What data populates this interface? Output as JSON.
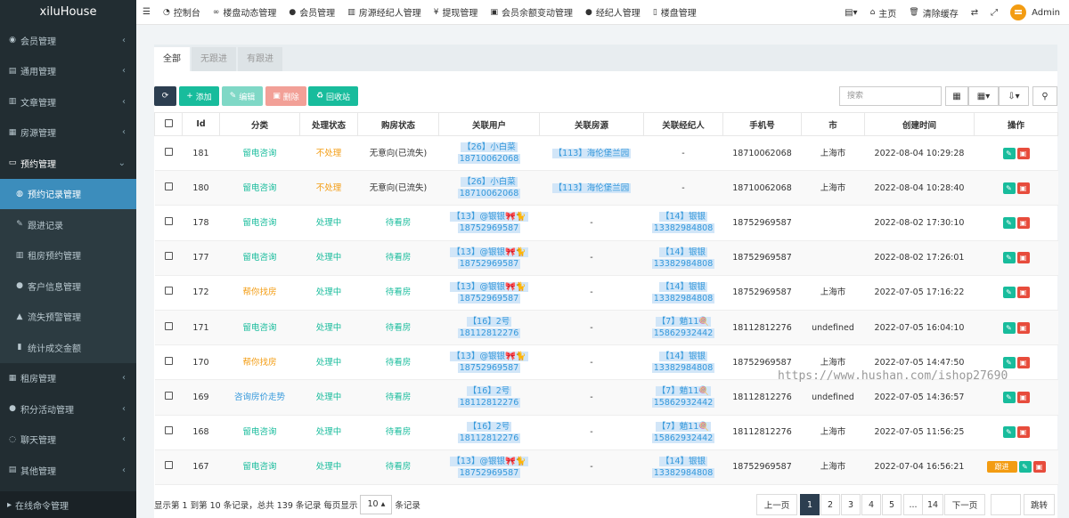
{
  "brand": "xiluHouse",
  "sidebar": {
    "items": [
      {
        "label": "会员管理",
        "icon": "user-circle-icon",
        "chev": "‹"
      },
      {
        "label": "通用管理",
        "icon": "list-icon",
        "chev": "‹"
      },
      {
        "label": "文章管理",
        "icon": "file-icon",
        "chev": "‹"
      },
      {
        "label": "房源管理",
        "icon": "table-icon",
        "chev": "‹"
      },
      {
        "label": "预约管理",
        "icon": "laptop-icon",
        "chev": "⌄"
      }
    ],
    "sub_items": [
      {
        "label": "预约记录管理",
        "icon": "globe-icon"
      },
      {
        "label": "跟进记录",
        "icon": "pen-icon"
      },
      {
        "label": "租房预约管理",
        "icon": "file-icon"
      },
      {
        "label": "客户信息管理",
        "icon": "user-icon"
      },
      {
        "label": "流失预警管理",
        "icon": "warning-icon"
      },
      {
        "label": "统计成交金额",
        "icon": "chart-icon"
      }
    ],
    "items2": [
      {
        "label": "租房管理",
        "icon": "table-icon",
        "chev": "‹"
      },
      {
        "label": "积分活动管理",
        "icon": "user-icon",
        "chev": "‹"
      },
      {
        "label": "聊天管理",
        "icon": "chat-icon",
        "chev": "‹"
      },
      {
        "label": "其他管理",
        "icon": "list-icon",
        "chev": "‹"
      }
    ],
    "bottom": "在线命令管理"
  },
  "topbar": {
    "nav": [
      {
        "label": "控制台",
        "icon": "dashboard-icon"
      },
      {
        "label": "楼盘动态管理",
        "icon": "glasses-icon"
      },
      {
        "label": "会员管理",
        "icon": "user-icon"
      },
      {
        "label": "房源经纪人管理",
        "icon": "building-icon"
      },
      {
        "label": "提现管理",
        "icon": "yen-icon"
      },
      {
        "label": "会员余额变动管理",
        "icon": "money-icon"
      },
      {
        "label": "经纪人管理",
        "icon": "user-icon"
      },
      {
        "label": "楼盘管理",
        "icon": "phone-icon"
      }
    ],
    "home": "主页",
    "clear_cache": "清除缓存",
    "admin": "Admin"
  },
  "tabs": [
    "全部",
    "无跟进",
    "有跟进"
  ],
  "toolbar": {
    "add": "添加",
    "edit": "编辑",
    "delete": "删除",
    "recycle": "回收站",
    "search_placeholder": "搜索"
  },
  "table": {
    "headers": [
      "Id",
      "分类",
      "处理状态",
      "购房状态",
      "关联用户",
      "关联房源",
      "关联经纪人",
      "手机号",
      "市",
      "创建时间",
      "操作"
    ],
    "rows": [
      {
        "id": "181",
        "cat": "留电咨询",
        "cat_color": "green",
        "status": "不处理",
        "status_color": "orange",
        "buy": "无意向(已流失)",
        "user1": "【26】小白菜",
        "user2": "18710062068",
        "house": "【113】海伦堡兰园",
        "agent1": "-",
        "agent2": "",
        "phone": "18710062068",
        "city": "上海市",
        "time": "2022-08-04 10:29:28",
        "follow": ""
      },
      {
        "id": "180",
        "cat": "留电咨询",
        "cat_color": "green",
        "status": "不处理",
        "status_color": "orange",
        "buy": "无意向(已流失)",
        "user1": "【26】小白菜",
        "user2": "18710062068",
        "house": "【113】海伦堡兰园",
        "agent1": "-",
        "agent2": "",
        "phone": "18710062068",
        "city": "上海市",
        "time": "2022-08-04 10:28:40",
        "follow": ""
      },
      {
        "id": "178",
        "cat": "留电咨询",
        "cat_color": "green",
        "status": "处理中",
        "status_color": "green",
        "buy": "待看房",
        "user1": "【13】@银银🎀🐈",
        "user2": "18752969587",
        "house": "-",
        "agent1": "【14】银银",
        "agent2": "13382984808",
        "phone": "18752969587",
        "city": "",
        "time": "2022-08-02 17:30:10",
        "follow": ""
      },
      {
        "id": "177",
        "cat": "留电咨询",
        "cat_color": "green",
        "status": "处理中",
        "status_color": "green",
        "buy": "待看房",
        "user1": "【13】@银银🎀🐈",
        "user2": "18752969587",
        "house": "-",
        "agent1": "【14】银银",
        "agent2": "13382984808",
        "phone": "18752969587",
        "city": "",
        "time": "2022-08-02 17:26:01",
        "follow": ""
      },
      {
        "id": "172",
        "cat": "帮你找房",
        "cat_color": "orange",
        "status": "处理中",
        "status_color": "green",
        "buy": "待看房",
        "user1": "【13】@银银🎀🐈",
        "user2": "18752969587",
        "house": "-",
        "agent1": "【14】银银",
        "agent2": "13382984808",
        "phone": "18752969587",
        "city": "上海市",
        "time": "2022-07-05 17:16:22",
        "follow": ""
      },
      {
        "id": "171",
        "cat": "留电咨询",
        "cat_color": "green",
        "status": "处理中",
        "status_color": "green",
        "buy": "待看房",
        "user1": "【16】2号",
        "user2": "18112812276",
        "house": "-",
        "agent1": "【7】魈11🍭",
        "agent2": "15862932442",
        "phone": "18112812276",
        "city": "undefined",
        "time": "2022-07-05 16:04:10",
        "follow": ""
      },
      {
        "id": "170",
        "cat": "帮你找房",
        "cat_color": "orange",
        "status": "处理中",
        "status_color": "green",
        "buy": "待看房",
        "user1": "【13】@银银🎀🐈",
        "user2": "18752969587",
        "house": "-",
        "agent1": "【14】银银",
        "agent2": "13382984808",
        "phone": "18752969587",
        "city": "上海市",
        "time": "2022-07-05 14:47:50",
        "follow": ""
      },
      {
        "id": "169",
        "cat": "咨询房价走势",
        "cat_color": "blue",
        "status": "处理中",
        "status_color": "green",
        "buy": "待看房",
        "user1": "【16】2号",
        "user2": "18112812276",
        "house": "-",
        "agent1": "【7】魈11🍭",
        "agent2": "15862932442",
        "phone": "18112812276",
        "city": "undefined",
        "time": "2022-07-05 14:36:57",
        "follow": ""
      },
      {
        "id": "168",
        "cat": "留电咨询",
        "cat_color": "green",
        "status": "处理中",
        "status_color": "green",
        "buy": "待看房",
        "user1": "【16】2号",
        "user2": "18112812276",
        "house": "-",
        "agent1": "【7】魈11🍭",
        "agent2": "15862932442",
        "phone": "18112812276",
        "city": "上海市",
        "time": "2022-07-05 11:56:25",
        "follow": ""
      },
      {
        "id": "167",
        "cat": "留电咨询",
        "cat_color": "green",
        "status": "处理中",
        "status_color": "green",
        "buy": "待看房",
        "user1": "【13】@银银🎀🐈",
        "user2": "18752969587",
        "house": "-",
        "agent1": "【14】银银",
        "agent2": "13382984808",
        "phone": "18752969587",
        "city": "上海市",
        "time": "2022-07-04 16:56:21",
        "follow": "跟进"
      }
    ]
  },
  "footer": {
    "summary": "显示第 1 到第 10 条记录，总共 139 条记录 每页显示",
    "page_size": "10",
    "suffix": "条记录",
    "prev": "上一页",
    "pages": [
      "1",
      "2",
      "3",
      "4",
      "5",
      "...",
      "14"
    ],
    "next": "下一页",
    "jump": "跳转"
  },
  "watermark": "https://www.hushan.com/ishop27690",
  "colors": {
    "sidebar_bg": "#222d32",
    "active": "#3c8dbc",
    "green": "#18bc9c",
    "orange": "#f39c12",
    "red": "#e74c3c",
    "dark": "#2c3e50"
  }
}
